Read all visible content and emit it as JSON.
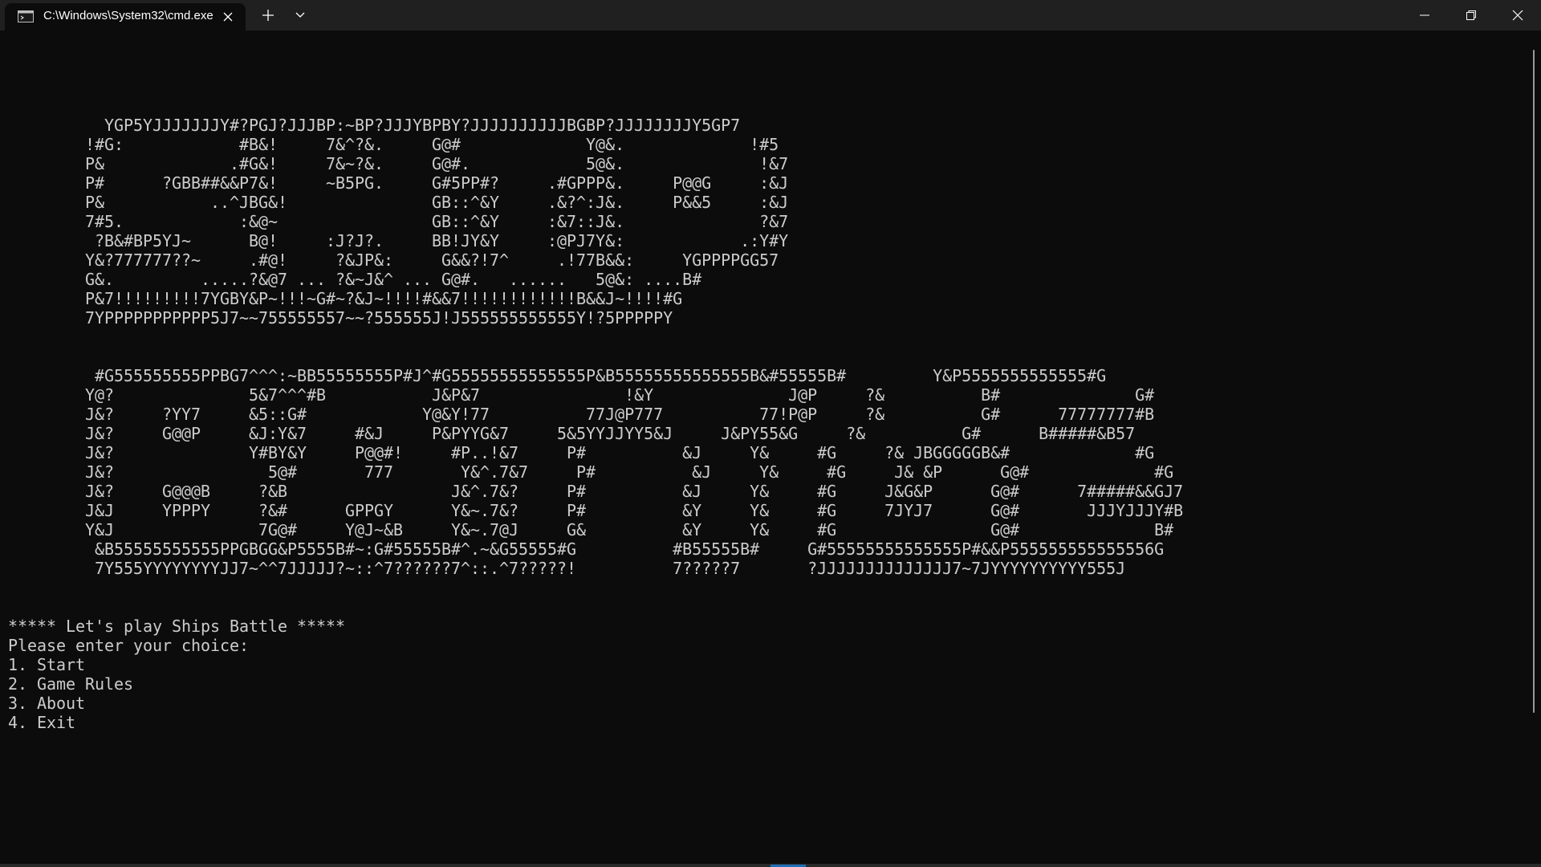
{
  "window": {
    "tab_title": "C:\\Windows\\System32\\cmd.exe",
    "tab_icon": "terminal-icon",
    "close_tab_icon": "close-icon",
    "new_tab_icon": "plus-icon",
    "dropdown_icon": "chevron-down-icon",
    "minimize_icon": "minimize-icon",
    "maximize_icon": "restore-icon",
    "close_window_icon": "close-icon"
  },
  "colors": {
    "background": "#0c0c0c",
    "titlebar": "#202020",
    "text": "#cccccc",
    "scroll_accent": "#1f6fb8"
  },
  "terminal": {
    "lines": [
      "",
      "",
      "",
      "",
      "          YGP5YJJJJJJJY#?PGJ?JJJBP:~BP?JJJYBPBY?JJJJJJJJJJBGBP?JJJJJJJJY5GP7",
      "        !#G:            #B&!     7&^?&.     G@#             Y@&.             !#5",
      "        P&             .#G&!     7&~?&.     G@#.            5@&.              !&7",
      "        P#      ?GBB##&&P7&!     ~B5PG.     G#5PP#?     .#GPPP&.     P@@G     :&J",
      "        P&           ..^JBG&!               GB::^&Y     .&?^:J&.     P&&5     :&J",
      "        7#5.            :&@~                GB::^&Y     :&7::J&.              ?&7",
      "         ?B&#BP5YJ~      B@!     :J?J?.     BB!JY&Y     :@PJ7Y&:            .:Y#Y",
      "        Y&?777777??~     .#@!     ?&JP&:     G&&?!7^     .!77B&&:     YGPPPPGG57",
      "        G&.         .....?&@7 ... ?&~J&^ ... G@#.   ......   5@&: ....B#",
      "        P&7!!!!!!!!!7YGBY&P~!!!~G#~?&J~!!!!#&&7!!!!!!!!!!!!B&&J~!!!!#G",
      "        7YPPPPPPPPPPP5J7~~755555557~~?555555J!J555555555555Y!?5PPPPPY",
      "",
      "",
      "         #G555555555PPBG7^^^:~BB55555555P#J^#G55555555555555P&B55555555555555B&#55555B#         Y&P5555555555555#G",
      "        Y@?              5&7^^^#B           J&P&7               !&Y              J@P     ?&          B#              G#",
      "        J&?     ?YY7     &5::G#            Y@&Y!77          77J@P777          77!P@P     ?&          G#      77777777#B",
      "        J&?     G@@P     &J:Y&7     #&J     P&PYYG&7     5&5YYJJYY5&J     J&PY55&G     ?&          G#      B#####&B57",
      "        J&?              Y#BY&Y     P@@#!     #P..!&7     P#          &J     Y&     #G     ?& JBGGGGGB&#             #G",
      "        J&?                5@#       777       Y&^.7&7     P#          &J     Y&     #G     J& &P      G@#             #G",
      "        J&?     G@@@B     ?&B                 J&^.7&?     P#          &J     Y&     #G     J&G&P      G@#      7#####&&GJ7",
      "        J&J     YPPPY     ?&#      GPPGY      Y&~.7&?     P#          &Y     Y&     #G     7JYJ7      G@#       JJJYJJJY#B",
      "        Y&J               7G@#     Y@J~&B     Y&~.7@J     G&          &Y     Y&     #G                G@#              B#",
      "         &B55555555555PPGBGG&P5555B#~:G#55555B#^.~&G55555#G          #B55555B#     G#55555555555555P#&&P555555555555556G",
      "         7Y555YYYYYYYYJJ7~^^7JJJJJ?~::^7??????7^::.^7?????!          7?????7       ?JJJJJJJJJJJJJJ7~7JYYYYYYYYYY555J",
      "",
      "",
      "***** Let's play Ships Battle *****",
      "Please enter your choice:",
      "1. Start",
      "2. Game Rules",
      "3. About",
      "4. Exit"
    ]
  }
}
